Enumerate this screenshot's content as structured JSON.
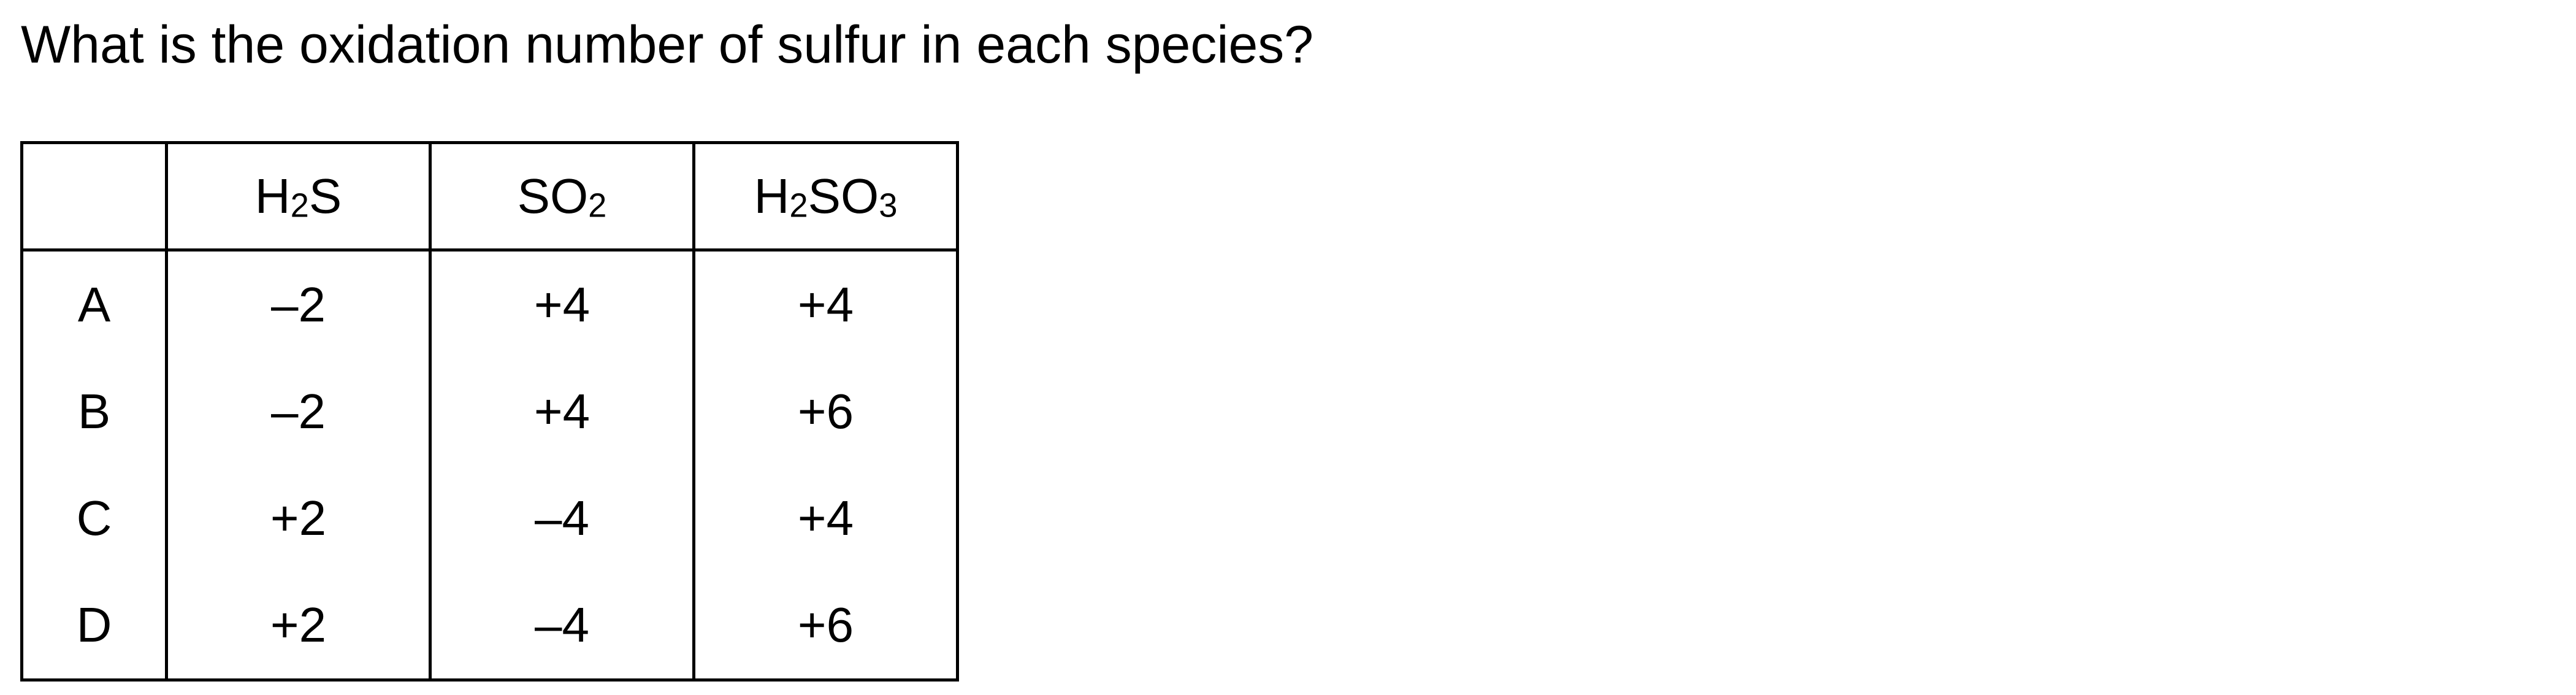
{
  "question": {
    "text": "What is the oxidation number of sulfur in each species?"
  },
  "table": {
    "columns": [
      {
        "parts": [
          {
            "t": "H"
          },
          {
            "sub": "2"
          },
          {
            "t": "S"
          }
        ]
      },
      {
        "parts": [
          {
            "t": "SO"
          },
          {
            "sub": "2"
          }
        ]
      },
      {
        "parts": [
          {
            "t": "H"
          },
          {
            "sub": "2"
          },
          {
            "t": "SO"
          },
          {
            "sub": "3"
          }
        ]
      }
    ],
    "rows": [
      {
        "key": "A",
        "values": [
          "–2",
          "+4",
          "+4"
        ]
      },
      {
        "key": "B",
        "values": [
          "–2",
          "+4",
          "+6"
        ]
      },
      {
        "key": "C",
        "values": [
          "+2",
          "–4",
          "+4"
        ]
      },
      {
        "key": "D",
        "values": [
          "+2",
          "–4",
          "+6"
        ]
      }
    ]
  }
}
